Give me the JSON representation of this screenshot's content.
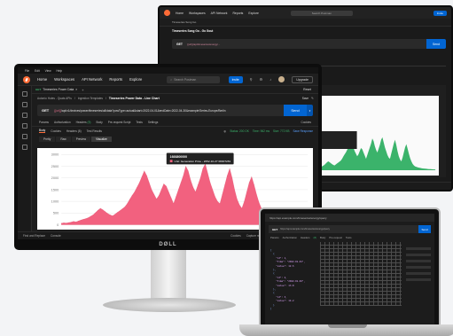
{
  "colors": {
    "accent": "#ff6c37",
    "send": "#0265d2",
    "chart_fill": "#f2617f",
    "ok": "#3bb36b"
  },
  "back_monitor": {
    "home": "Home",
    "workspaces": "Workspaces",
    "api_network": "API Network",
    "reports": "Reports",
    "explore": "Explore",
    "search": "Search Postman",
    "invite": "Invite",
    "tab": "Timeseries Song Go",
    "breadcrumb": "Timeseries Song Go - Go Gout",
    "method": "GET",
    "url": "{{url}}/api/timeseries/energy/...",
    "send": "Send"
  },
  "main": {
    "menu": [
      "File",
      "Edit",
      "View",
      "Help"
    ],
    "nav": {
      "home": "Home",
      "workspaces": "Workspaces",
      "api_network": "API Network",
      "reports": "Reports",
      "explore": "Explore"
    },
    "search_placeholder": "Search Postman",
    "invite": "Invite",
    "upgrade": "Upgrade",
    "tab_method": "GET",
    "tab_label": "Timeseries Power Data",
    "environment": "Reset",
    "breadcrumb": {
      "a": "Autonio Hutes - Quats APIs",
      "b": "Ingestion Templates",
      "title": "Timeseries Power Data - Line Chart"
    },
    "save": "Save",
    "request": {
      "method": "GET",
      "url_var": "{{url}}",
      "url_rest": "/api/v1/devices/power/timeseries/all/data?powType=actual&start=2022-04-01&endDate=2022-04-30&example/Series-Europe/Berlin",
      "send": "Send"
    },
    "req_tabs": {
      "params": "Params",
      "auth": "Authorization",
      "headers": "Headers",
      "headers_count": "(9)",
      "body": "Body",
      "prereq": "Pre-request Script",
      "tests": "Tests",
      "settings": "Settings",
      "cookies": "Cookies"
    },
    "resp_tabs": {
      "body": "Body",
      "cookies": "Cookies",
      "headers": "Headers",
      "headers_count": "(8)",
      "results": "Test Results"
    },
    "status": {
      "code": "Status: 200 OK",
      "time": "Time: 962 ms",
      "size": "Size: 772 KB",
      "save": "Save Response"
    },
    "view_tabs": [
      "Pretty",
      "Raw",
      "Preview",
      "Visualize"
    ],
    "statusbar": {
      "left": "Find and Replace",
      "console": "Console",
      "cookies": "Cookies",
      "capture": "Capture requests",
      "bootcamp": "Bootcamp",
      "runner": "Runner",
      "trash": "Trash"
    },
    "brand": "DØLL"
  },
  "chart_data": {
    "type": "area",
    "title": "",
    "yticks": [
      "3000",
      "2500",
      "2000",
      "1500",
      "1000",
      "500",
      "0"
    ],
    "ylim": [
      0,
      3000
    ],
    "tooltip": {
      "title": "1666800000",
      "label": "Unit: Generation Price - 2052-10-27 08007281"
    },
    "values": [
      60,
      80,
      70,
      90,
      110,
      140,
      120,
      160,
      200,
      230,
      260,
      300,
      360,
      420,
      520,
      620,
      700,
      640,
      560,
      480,
      420,
      380,
      450,
      530,
      600,
      680,
      760,
      900,
      1080,
      1250,
      1400,
      1600,
      1800,
      2050,
      2300,
      2100,
      1800,
      1500,
      1300,
      1100,
      1250,
      1500,
      1750,
      1650,
      1400,
      1150,
      900,
      1200,
      1500,
      1800,
      2100,
      2500,
      2300,
      1900,
      1600,
      1400,
      1700,
      2000,
      2400,
      2600,
      2200,
      1800,
      1500,
      1200,
      1000,
      900,
      1300,
      1700,
      2100,
      2400,
      2000,
      1500,
      1100,
      850,
      700,
      1000,
      1400,
      1800,
      2050,
      1700,
      1300,
      950,
      700,
      500,
      380,
      300,
      260,
      230,
      200,
      180,
      160,
      140,
      130,
      120,
      110,
      100,
      90,
      85,
      80,
      70,
      65,
      60
    ]
  },
  "laptop": {
    "method": "GET",
    "url": "https://api.example.com/timeseries/energy/query",
    "send": "Send",
    "tabs": [
      "Params",
      "Authorization",
      "Headers",
      "(8)",
      "Body",
      "Pre-request",
      "Tests"
    ],
    "code": [
      "[",
      "  {",
      "    \"id\": 1,",
      "    \"time\": \"2022-01-01\",",
      "    \"value\": 12.5",
      "  },",
      "  {",
      "    \"id\": 2,",
      "    \"time\": \"2022-01-02\",",
      "    \"value\": 13.8",
      "  },",
      "  {",
      "    \"id\": 3,",
      "    \"value\": 14.2",
      "  }",
      "]"
    ]
  }
}
